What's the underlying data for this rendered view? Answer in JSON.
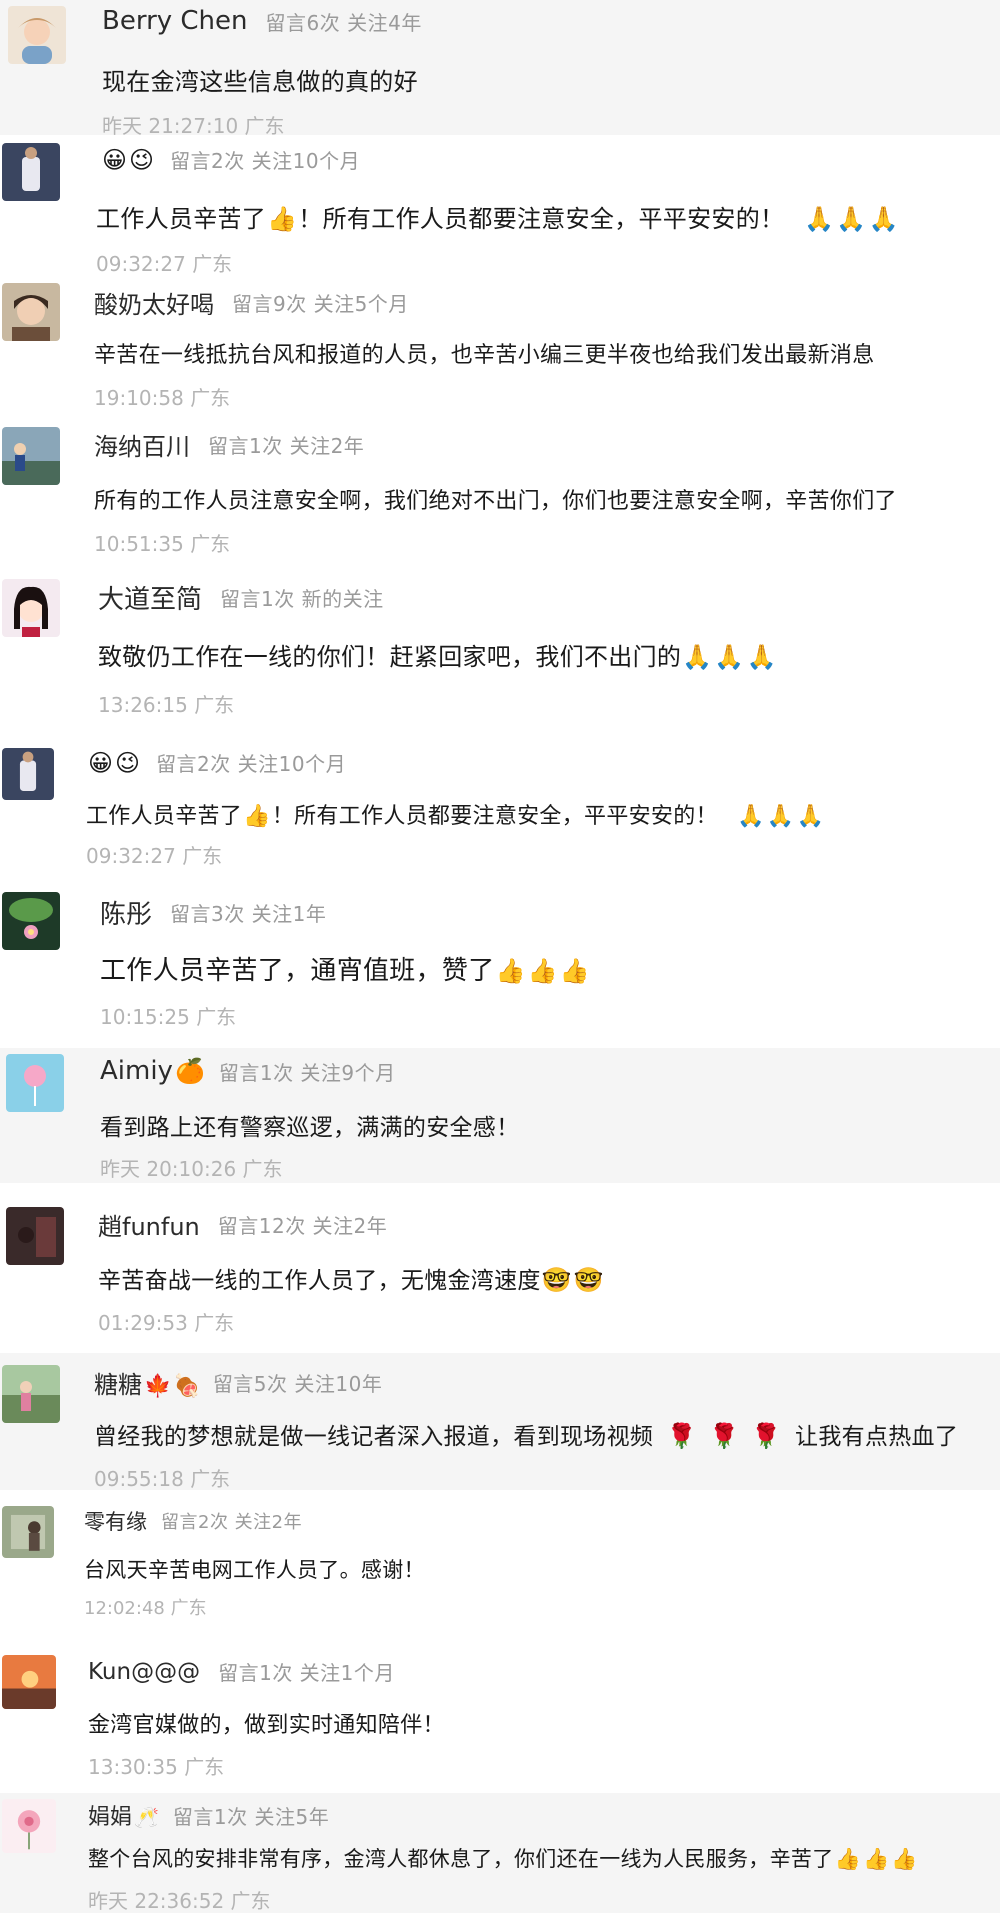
{
  "comments": [
    {
      "name": "Berry Chen",
      "stats": "留言6次 关注4年",
      "text": "现在金湾这些信息做的真的好",
      "time": "昨天 21:27:10",
      "location": "广东"
    },
    {
      "name_emoji": [
        "😀",
        "😉"
      ],
      "stats": "留言2次 关注10个月",
      "text_a": "工作人员辛苦了",
      "text_b": "！所有工作人员都要注意安全，平平安安的！",
      "time": "09:32:27",
      "location": "广东"
    },
    {
      "name": "酸奶太好喝",
      "stats": "留言9次 关注5个月",
      "text": "辛苦在一线抵抗台风和报道的人员，也辛苦小编三更半夜也给我们发出最新消息",
      "time": "19:10:58",
      "location": "广东"
    },
    {
      "name": "海纳百川",
      "stats": "留言1次 关注2年",
      "text": "所有的工作人员注意安全啊，我们绝对不出门，你们也要注意安全啊，辛苦你们了",
      "time": "10:51:35",
      "location": "广东"
    },
    {
      "name": "大道至简",
      "stats": "留言1次 新的关注",
      "text": "致敬仍工作在一线的你们！赶紧回家吧，我们不出门的",
      "time": "13:26:15",
      "location": "广东"
    },
    {
      "name_emoji": [
        "😀",
        "😉"
      ],
      "stats": "留言2次 关注10个月",
      "text_a": "工作人员辛苦了",
      "text_b": "！所有工作人员都要注意安全，平平安安的！",
      "time": "09:32:27",
      "location": "广东"
    },
    {
      "name": "陈彤",
      "stats": "留言3次 关注1年",
      "text": "工作人员辛苦了，通宵值班，赞了",
      "time": "10:15:25",
      "location": "广东"
    },
    {
      "name": "Aimiy",
      "stats": "留言1次 关注9个月",
      "text": "看到路上还有警察巡逻，满满的安全感！",
      "time": "昨天 20:10:26",
      "location": "广东"
    },
    {
      "name": "趙funfun",
      "stats": "留言12次 关注2年",
      "text": "辛苦奋战一线的工作人员了，无愧金湾速度",
      "time": "01:29:53",
      "location": "广东"
    },
    {
      "name": "糖糖",
      "stats": "留言5次 关注10年",
      "text_a": "曾经我的梦想就是做一线记者深入报道，看到现场视频",
      "text_b": "让我有点热血了",
      "time": "09:55:18",
      "location": "广东"
    },
    {
      "name": "零有缘",
      "stats": "留言2次 关注2年",
      "text": "台风天辛苦电网工作人员了。感谢！",
      "time": "12:02:48",
      "location": "广东"
    },
    {
      "name": "Kun@@@",
      "stats": "留言1次 关注1个月",
      "text": "金湾官媒做的，做到实时通知陪伴！",
      "time": "13:30:35",
      "location": "广东"
    },
    {
      "name": "娟娟",
      "stats": "留言1次 关注5年",
      "text": "整个台风的安排非常有序，金湾人都休息了，你们还在一线为人民服务，辛苦了",
      "time": "昨天 22:36:52",
      "location": "广东"
    }
  ],
  "icons": {
    "thumbs_up": "👍",
    "pray": "🙏",
    "orange": "🍊",
    "leaf": "🍁",
    "meat": "🍖",
    "rose": "🌹",
    "cheers": "🥂",
    "nerd": "🤓"
  }
}
